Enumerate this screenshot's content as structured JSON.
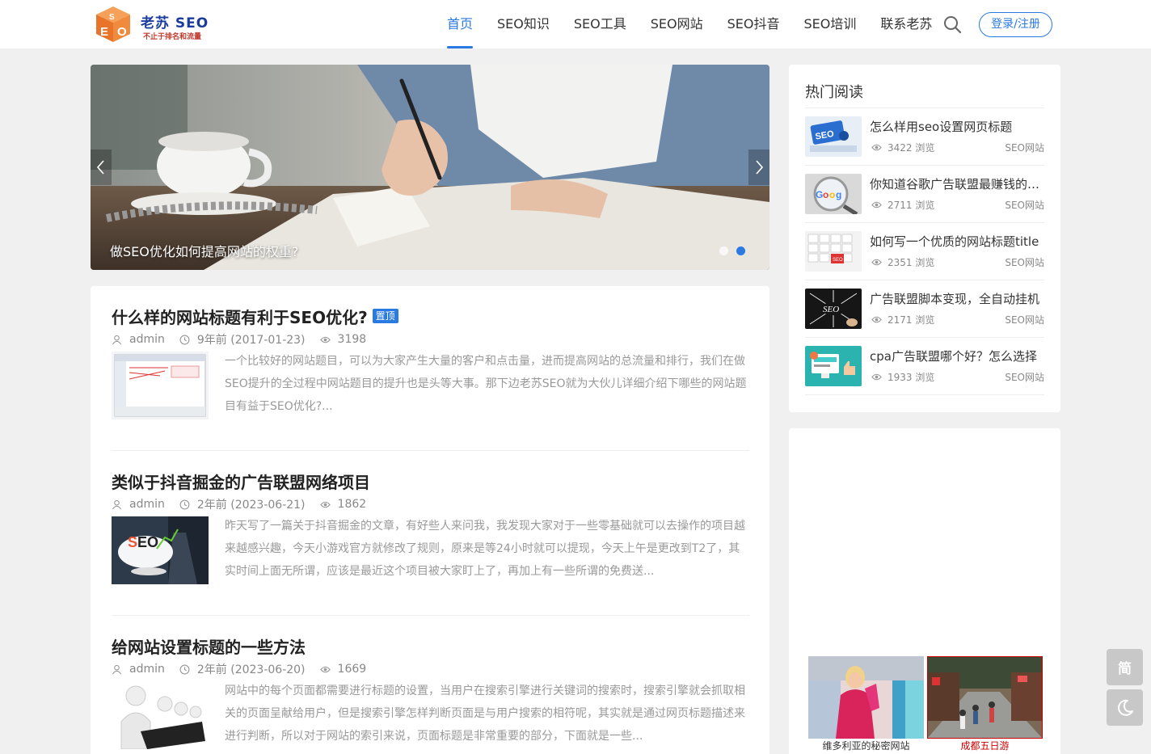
{
  "header": {
    "logo_title": "老苏 SEO",
    "logo_tagline": "不止于排名和流量",
    "nav": [
      {
        "label": "首页",
        "active": true
      },
      {
        "label": "SEO知识",
        "active": false
      },
      {
        "label": "SEO工具",
        "active": false
      },
      {
        "label": "SEO网站",
        "active": false
      },
      {
        "label": "SEO抖音",
        "active": false
      },
      {
        "label": "SEO培训",
        "active": false
      },
      {
        "label": "联系老苏",
        "active": false
      }
    ],
    "search_icon": "search-icon",
    "login_label": "登录/注册"
  },
  "slider": {
    "caption": "做SEO优化如何提高网站的权重?",
    "prev_icon": "chevron-left-icon",
    "next_icon": "chevron-right-icon",
    "dots": 2,
    "active_dot": 2
  },
  "posts": [
    {
      "title": "什么样的网站标题有利于SEO优化?",
      "badge": "置顶",
      "author": "admin",
      "date": "9年前 (2017-01-23)",
      "views": "3198",
      "excerpt": "一个比较好的网站题目，可以为大家产生大量的客户和点击量，进而提高网站的总流量和排行，我们在做SEO提升的全过程中网站题目的提升也是头等大事。那下边老苏SEO就为大伙儿详细介绍下哪些的网站题目有益于SEO优化?..."
    },
    {
      "title": "类似于抖音掘金的广告联盟网络项目",
      "badge": "",
      "author": "admin",
      "date": "2年前 (2023-06-21)",
      "views": "1862",
      "excerpt": "昨天写了一篇关于抖音掘金的文章，有好些人来问我，我发现大家对于一些零基础就可以去操作的项目越来越感兴趣，今天小游戏官方就修改了规则，原来是等24小时就可以提现，今天上午是更改到T2了，其实时间上面无所谓，应该是最近这个项目被大家盯上了，再加上有一些所谓的免费送..."
    },
    {
      "title": "给网站设置标题的一些方法",
      "badge": "",
      "author": "admin",
      "date": "2年前 (2023-06-20)",
      "views": "1669",
      "excerpt": "网站中的每个页面都需要进行标题的设置，当用户在搜索引擎进行关键词的搜索时，搜索引擎就会抓取相关的页面呈献给用户，但是搜索引擎怎样判断页面是与用户搜索的相符呢，其实就是通过网页标题描述来进行判断，所以对于网站的索引来说，页面标题是非常重要的部分，下面就是一些..."
    }
  ],
  "hot": {
    "title": "热门阅读",
    "items": [
      {
        "title": "怎么样用seo设置网页标题",
        "views": "3422 浏览",
        "category": "SEO网站"
      },
      {
        "title": "你知道谷歌广告联盟最赚钱的方法吗",
        "views": "2711 浏览",
        "category": "SEO网站"
      },
      {
        "title": "如何写一个优质的网站标题title",
        "views": "2351 浏览",
        "category": "SEO网站"
      },
      {
        "title": "广告联盟脚本变现，全自动挂机",
        "views": "2171 浏览",
        "category": "SEO网站"
      },
      {
        "title": "cpa广告联盟哪个好？怎么选择",
        "views": "1933 浏览",
        "category": "SEO网站"
      }
    ]
  },
  "ad": {
    "cards": [
      {
        "caption": "维多利亚的秘密网站",
        "color": "#333333"
      },
      {
        "caption": "成都五日游",
        "color": "#cc0000"
      }
    ]
  },
  "floating": {
    "simplified_label": "简",
    "dark_mode_icon": "moon-icon"
  },
  "colors": {
    "accent": "#2a7ae2",
    "background": "#f0f0f0"
  }
}
